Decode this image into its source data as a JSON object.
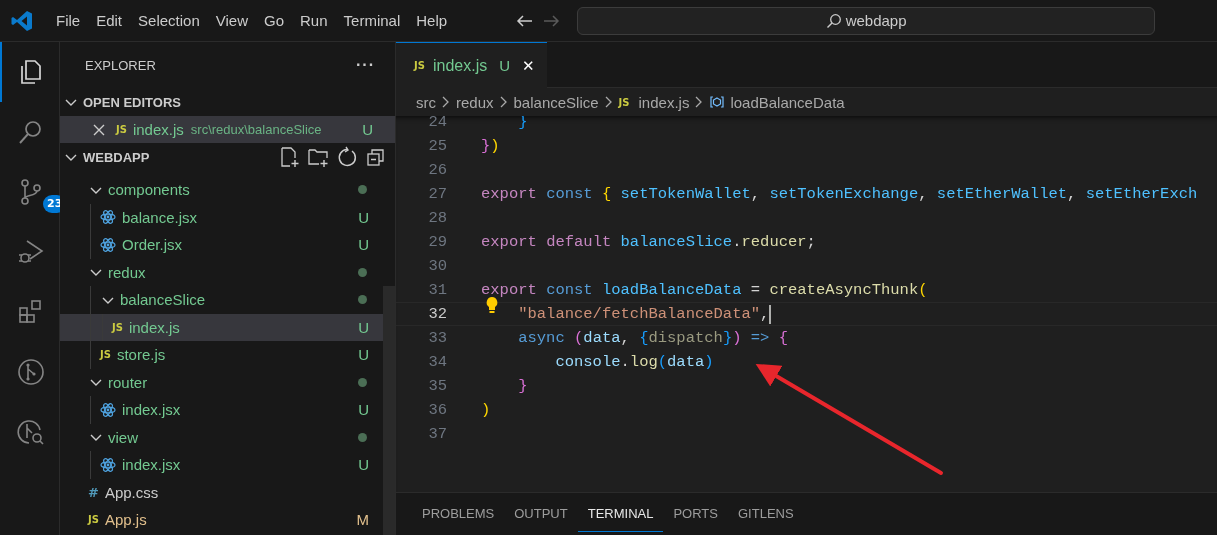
{
  "menu": [
    "File",
    "Edit",
    "Selection",
    "View",
    "Go",
    "Run",
    "Terminal",
    "Help"
  ],
  "navigation": [
    {
      "kind": "back",
      "disabled": false
    },
    {
      "kind": "forward",
      "disabled": true
    }
  ],
  "search": {
    "value": "webdapp"
  },
  "activity_bar": [
    {
      "selected": true
    },
    {
      "selected": false
    },
    {
      "selected": false,
      "badge": "23"
    },
    {
      "selected": false
    },
    {
      "selected": false
    },
    {
      "selected": false
    },
    {
      "selected": false
    }
  ],
  "sidebar": {
    "title": "EXPLORER",
    "more": "···",
    "sections": [
      {
        "title": "OPEN EDITORS",
        "expanded": true
      },
      {
        "title": "WEBDAPP",
        "expanded": true
      }
    ],
    "open_editors": [
      {
        "label": "index.js",
        "kind": "js",
        "icon_text": "JS",
        "path": "src\\redux\\balanceSlice",
        "color": "#73c991",
        "badge": "U",
        "selected": true
      }
    ],
    "tree": [
      {
        "label": "components",
        "kind": "folder",
        "expanded": true,
        "selected": false,
        "color": "#73c991",
        "changes": true,
        "children": [
          {
            "label": "balance.jsx",
            "kind": "react",
            "selected": false,
            "color": "#73c991",
            "badge": "U"
          },
          {
            "label": "Order.jsx",
            "kind": "react",
            "selected": false,
            "color": "#73c991",
            "badge": "U"
          }
        ]
      },
      {
        "label": "redux",
        "kind": "folder",
        "expanded": true,
        "selected": false,
        "color": "#73c991",
        "changes": true,
        "children": [
          {
            "label": "balanceSlice",
            "kind": "folder",
            "expanded": true,
            "selected": false,
            "color": "#73c991",
            "changes": true,
            "children": [
              {
                "label": "index.js",
                "kind": "js",
                "icon_text": "JS",
                "selected": true,
                "color": "#73c991",
                "badge": "U"
              }
            ]
          },
          {
            "label": "store.js",
            "kind": "js",
            "icon_text": "JS",
            "selected": false,
            "color": "#73c991",
            "badge": "U"
          }
        ]
      },
      {
        "label": "router",
        "kind": "folder",
        "expanded": true,
        "selected": false,
        "color": "#73c991",
        "changes": true,
        "children": [
          {
            "label": "index.jsx",
            "kind": "react",
            "selected": false,
            "color": "#73c991",
            "badge": "U"
          }
        ]
      },
      {
        "label": "view",
        "kind": "folder",
        "expanded": true,
        "selected": false,
        "color": "#73c991",
        "changes": true,
        "children": [
          {
            "label": "index.jsx",
            "kind": "react",
            "selected": false,
            "color": "#73c991",
            "badge": "U"
          }
        ]
      },
      {
        "label": "App.css",
        "kind": "css",
        "icon_text": "#",
        "selected": false,
        "color": "#cccccc"
      },
      {
        "label": "App.js",
        "kind": "js",
        "icon_text": "JS",
        "selected": false,
        "color": "#e2c08d",
        "badge": "M"
      }
    ]
  },
  "tabs": [
    {
      "label": "index.js",
      "kind": "js",
      "icon_text": "JS",
      "color": "#73c991",
      "badge": "U",
      "selected": true,
      "close": "✕"
    }
  ],
  "breadcrumbs": [
    {
      "label": "src",
      "kind": "folder"
    },
    {
      "label": "redux",
      "kind": "folder"
    },
    {
      "label": "balanceSlice",
      "kind": "folder"
    },
    {
      "label": "index.js",
      "kind": "js",
      "icon_text": "JS"
    },
    {
      "label": "loadBalanceData",
      "kind": "symbol"
    }
  ],
  "code": [
    {
      "number": "24",
      "current": false,
      "tokens": [
        {
          "text": "    }",
          "kind": "bracket3"
        }
      ]
    },
    {
      "number": "25",
      "current": false,
      "tokens": [
        {
          "text": "}",
          "kind": "bracket2"
        },
        {
          "text": ")",
          "kind": "bracket1"
        }
      ]
    },
    {
      "number": "26",
      "current": false
    },
    {
      "number": "27",
      "current": false,
      "tokens": [
        {
          "text": "export ",
          "kind": "keyword"
        },
        {
          "text": "const ",
          "kind": "storage"
        },
        {
          "text": "{ ",
          "kind": "bracket1"
        },
        {
          "text": "setTokenWallet",
          "kind": "constant"
        },
        {
          "text": ", ",
          "kind": "punct"
        },
        {
          "text": "setTokenExchange",
          "kind": "constant"
        },
        {
          "text": ", ",
          "kind": "punct"
        },
        {
          "text": "setEtherWallet",
          "kind": "constant"
        },
        {
          "text": ", ",
          "kind": "punct"
        },
        {
          "text": "setEtherExch",
          "kind": "constant"
        }
      ]
    },
    {
      "number": "28",
      "current": false
    },
    {
      "number": "29",
      "current": false,
      "tokens": [
        {
          "text": "export ",
          "kind": "keyword"
        },
        {
          "text": "default ",
          "kind": "keyword"
        },
        {
          "text": "balanceSlice",
          "kind": "constant"
        },
        {
          "text": ".",
          "kind": "punct"
        },
        {
          "text": "reducer",
          "kind": "function"
        },
        {
          "text": ";",
          "kind": "punct"
        }
      ]
    },
    {
      "number": "30",
      "current": false
    },
    {
      "number": "31",
      "current": false,
      "tokens": [
        {
          "text": "export ",
          "kind": "keyword"
        },
        {
          "text": "const ",
          "kind": "storage"
        },
        {
          "text": "loadBalanceData",
          "kind": "constant"
        },
        {
          "text": " = ",
          "kind": "punct"
        },
        {
          "text": "createAsyncThunk",
          "kind": "function"
        },
        {
          "text": "(",
          "kind": "bracket1"
        }
      ]
    },
    {
      "number": "32",
      "current": true,
      "lightbulb": true,
      "cursor": true,
      "tokens": [
        {
          "text": "    \"balance/fetchBalanceData\"",
          "kind": "string"
        },
        {
          "text": ",",
          "kind": "punct"
        }
      ]
    },
    {
      "number": "33",
      "current": false,
      "tokens": [
        {
          "text": "    async ",
          "kind": "storage"
        },
        {
          "text": "(",
          "kind": "bracket2"
        },
        {
          "text": "data",
          "kind": "variable"
        },
        {
          "text": ", ",
          "kind": "punct"
        },
        {
          "text": "{",
          "kind": "bracket3"
        },
        {
          "text": "dispatch",
          "kind": "unused"
        },
        {
          "text": "}",
          "kind": "bracket3"
        },
        {
          "text": ")",
          "kind": "bracket2"
        },
        {
          "text": " => ",
          "kind": "storage"
        },
        {
          "text": "{",
          "kind": "bracket2"
        }
      ]
    },
    {
      "number": "34",
      "current": false,
      "tokens": [
        {
          "text": "        console",
          "kind": "variable"
        },
        {
          "text": ".",
          "kind": "punct"
        },
        {
          "text": "log",
          "kind": "function"
        },
        {
          "text": "(",
          "kind": "bracket3"
        },
        {
          "text": "data",
          "kind": "variable"
        },
        {
          "text": ")",
          "kind": "bracket3"
        }
      ]
    },
    {
      "number": "35",
      "current": false,
      "tokens": [
        {
          "text": "    }",
          "kind": "bracket2"
        }
      ]
    },
    {
      "number": "36",
      "current": false,
      "tokens": [
        {
          "text": ")",
          "kind": "bracket1"
        }
      ]
    },
    {
      "number": "37",
      "current": false
    }
  ],
  "annotation": {
    "kind": "arrow"
  },
  "panel_tabs": [
    {
      "label": "PROBLEMS",
      "selected": false
    },
    {
      "label": "OUTPUT",
      "selected": false
    },
    {
      "label": "TERMINAL",
      "selected": true
    },
    {
      "label": "PORTS",
      "selected": false
    },
    {
      "label": "GITLENS",
      "selected": false
    }
  ]
}
